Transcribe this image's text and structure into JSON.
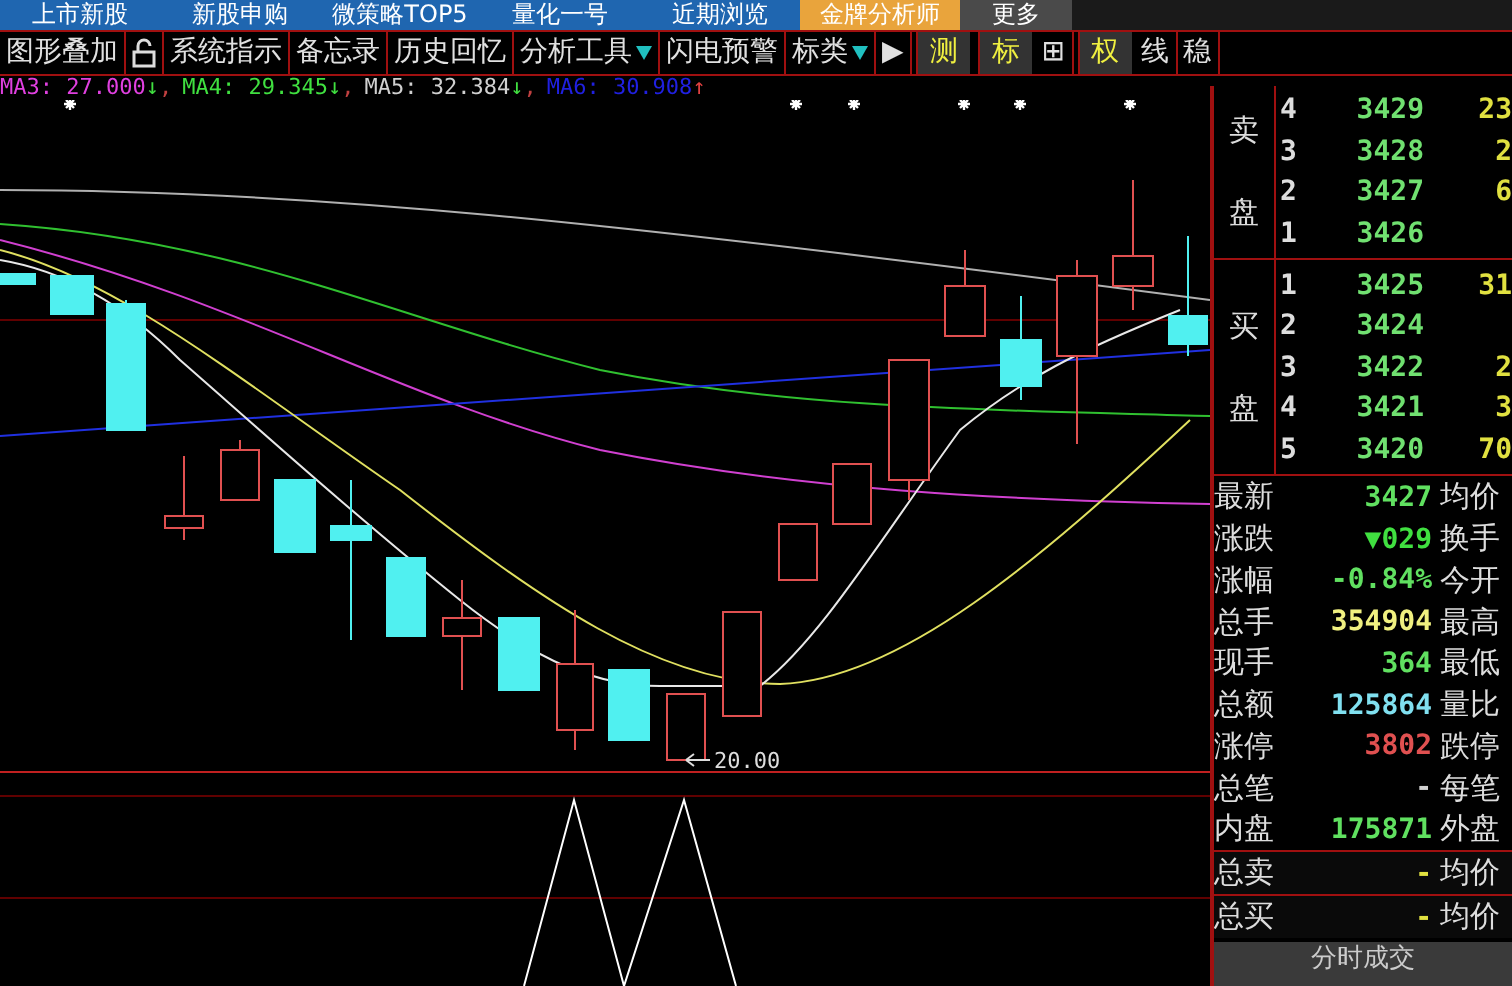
{
  "tabs": [
    {
      "label": "上市新股",
      "selected": false
    },
    {
      "label": "新股申购",
      "selected": false
    },
    {
      "label": "微策略TOP5",
      "selected": false
    },
    {
      "label": "量化一号",
      "selected": false
    },
    {
      "label": "近期浏览",
      "selected": false
    },
    {
      "label": "金牌分析师",
      "selected": true
    },
    {
      "label": "更多",
      "selected": false
    }
  ],
  "toolbar": [
    {
      "kind": "text",
      "label": "图形叠加"
    },
    {
      "kind": "lock"
    },
    {
      "kind": "text",
      "label": "系统指示"
    },
    {
      "kind": "text",
      "label": "备忘录"
    },
    {
      "kind": "text",
      "label": "历史回忆"
    },
    {
      "kind": "menu",
      "label": "分析工具"
    },
    {
      "kind": "text",
      "label": "闪电预警"
    },
    {
      "kind": "menu",
      "label": "标类"
    },
    {
      "kind": "text",
      "label": "▶"
    },
    {
      "kind": "toggle",
      "label": "测"
    },
    {
      "kind": "toggle",
      "label": "标"
    },
    {
      "kind": "text",
      "label": "⊞"
    },
    {
      "kind": "toggle",
      "label": "权"
    },
    {
      "kind": "text",
      "label": "线"
    },
    {
      "kind": "text",
      "label": "稳"
    }
  ],
  "moving_averages": [
    {
      "text": "MA3: 27.000",
      "color": "#e040e0",
      "sep": ","
    },
    {
      "text": "MA4: 29.345",
      "color": "#40e040",
      "sep": ","
    },
    {
      "text": "MA5: 32.384",
      "color": "#d0d0d0",
      "sep": ","
    },
    {
      "text": "MA6: 30.908",
      "color": "#2020e0"
    }
  ],
  "trend_arrows": [
    {
      "arrow": "↓",
      "color": "#40e040"
    },
    {
      "arrow": "↓",
      "color": "#40e040"
    },
    {
      "arrow": "↓",
      "color": "#40e040"
    },
    {
      "arrow": "↑",
      "color": "#e04040"
    }
  ],
  "chart": {
    "low_label": "20.00"
  },
  "order_book": {
    "sell": {
      "label": "卖盘",
      "rows": [
        {
          "rank": "4",
          "price": "3429",
          "volume": "23"
        },
        {
          "rank": "3",
          "price": "3428",
          "volume": "2"
        },
        {
          "rank": "2",
          "price": "3427",
          "volume": "6"
        },
        {
          "rank": "1",
          "price": "3426"
        }
      ]
    },
    "buy": {
      "label": "买盘",
      "rows": [
        {
          "rank": "1",
          "price": "3425",
          "volume": "31"
        },
        {
          "rank": "2",
          "price": "3424"
        },
        {
          "rank": "3",
          "price": "3422",
          "volume": "2"
        },
        {
          "rank": "4",
          "price": "3421",
          "volume": "3"
        },
        {
          "rank": "5",
          "price": "3420",
          "volume": "70"
        }
      ]
    }
  },
  "quote_stats": [
    {
      "label": "最新",
      "value": "3427",
      "color": "#60e060",
      "label2": "均价"
    },
    {
      "label": "涨跌",
      "value": "▼029",
      "color": "#40e040",
      "label2": "换手"
    },
    {
      "label": "涨幅",
      "value": "-0.84%",
      "color": "#60e060",
      "label2": "今开"
    },
    {
      "label": "总手",
      "value": "354904",
      "color": "#f0f080",
      "label2": "最高"
    },
    {
      "label": "现手",
      "value": "364",
      "color": "#60e060",
      "label2": "最低"
    },
    {
      "label": "总额",
      "value": "125864",
      "color": "#80e0f0",
      "label2": "量比"
    },
    {
      "label": "涨停",
      "value": "3802",
      "color": "#e05050",
      "label2": "跌停"
    },
    {
      "label": "总笔",
      "value": "-",
      "color": "#d0d0d0",
      "label2": "每笔"
    },
    {
      "label": "内盘",
      "value": "175871",
      "color": "#60e060",
      "label2": "外盘"
    }
  ],
  "totals": [
    {
      "label": "总卖",
      "value": "-",
      "label2": "均价"
    },
    {
      "label": "总买",
      "value": "-",
      "label2": "均价"
    }
  ],
  "footer": "分时成交"
}
